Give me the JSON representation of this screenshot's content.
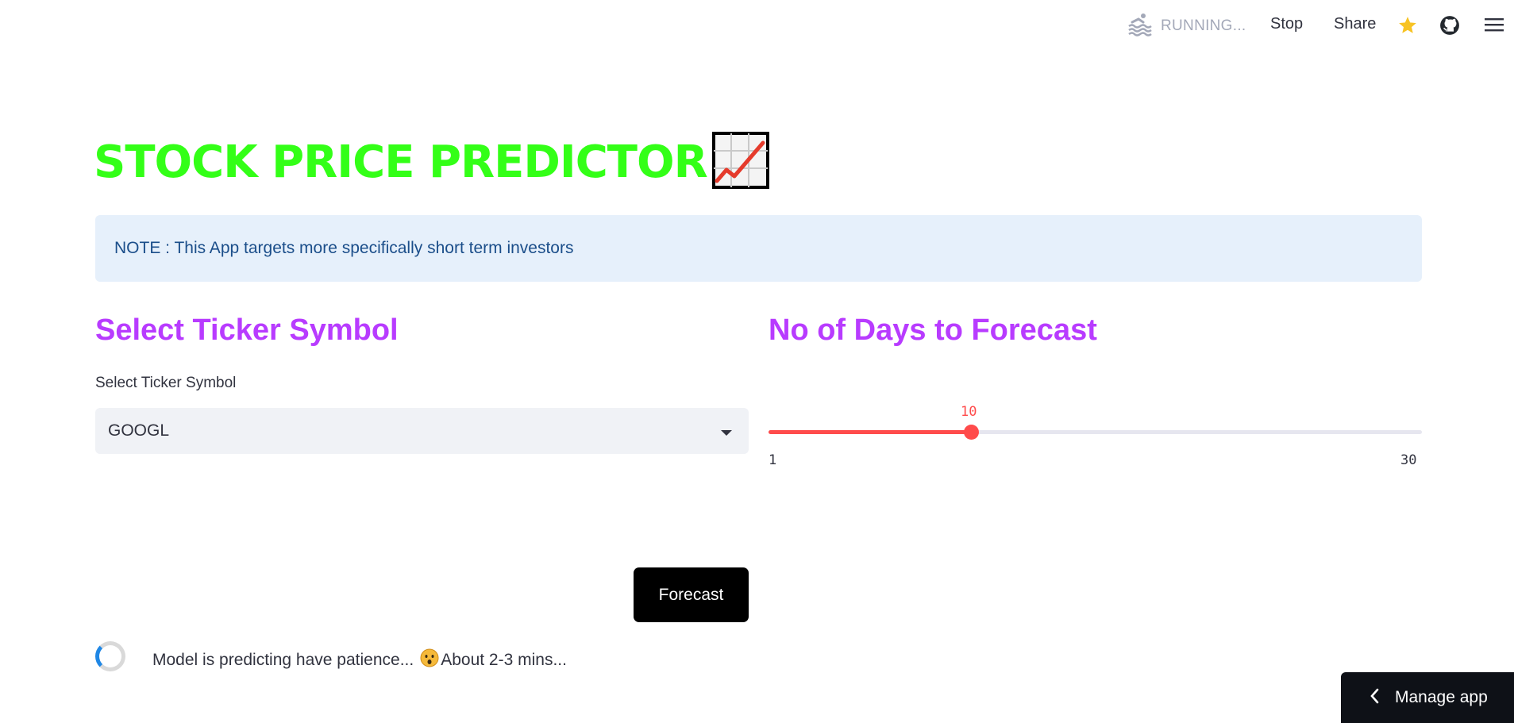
{
  "header": {
    "status": "RUNNING...",
    "stop_label": "Stop",
    "share_label": "Share",
    "icons": [
      "swimmer-icon",
      "star-icon",
      "github-icon",
      "hamburger-menu-icon"
    ]
  },
  "main": {
    "title": "STOCK PRICE PREDICTOR",
    "title_color": "#33ff17",
    "title_emoji": "chart-increasing-icon",
    "note": "NOTE : This App targets more specifically short term investors",
    "left": {
      "heading": "Select Ticker Symbol",
      "select_label": "Select Ticker Symbol",
      "select_value": "GOOGL"
    },
    "right": {
      "heading": "No of Days to Forecast",
      "slider": {
        "value": "10",
        "min": "1",
        "max": "30"
      }
    },
    "heading_color": "#b83bff",
    "forecast_button": "Forecast",
    "status_message": "Model is predicting have patience...",
    "status_suffix": "About 2-3 mins..."
  },
  "footer": {
    "manage_app": "Manage app"
  },
  "colors": {
    "accent": "#ff4b4b",
    "info_bg": "#e6f0fb",
    "info_text": "#1b4e8a"
  }
}
